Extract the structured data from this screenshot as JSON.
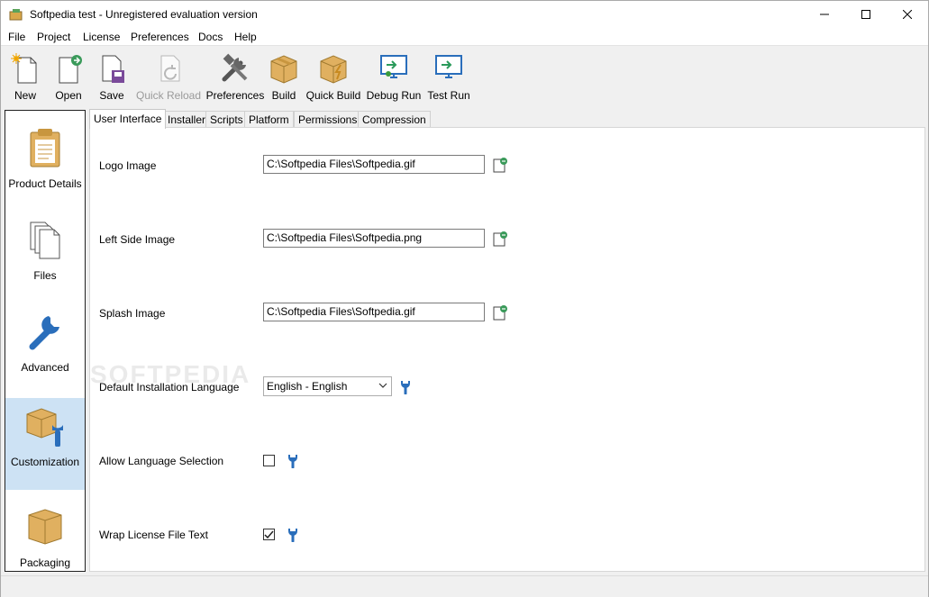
{
  "window": {
    "title": "Softpedia test - Unregistered evaluation version"
  },
  "menu": [
    "File",
    "Project",
    "License",
    "Preferences",
    "Docs",
    "Help"
  ],
  "toolbar": {
    "new": "New",
    "open": "Open",
    "save": "Save",
    "quick_reload": "Quick Reload",
    "preferences": "Preferences",
    "build": "Build",
    "quick_build": "Quick Build",
    "debug_run": "Debug Run",
    "test_run": "Test Run"
  },
  "sidebar": {
    "items": [
      {
        "label": "Product Details"
      },
      {
        "label": "Files"
      },
      {
        "label": "Advanced"
      },
      {
        "label": "Customization"
      },
      {
        "label": "Packaging"
      }
    ],
    "active": "Customization"
  },
  "tabs": [
    "User Interface",
    "Installer",
    "Scripts",
    "Platform",
    "Permissions",
    "Compression"
  ],
  "form": {
    "logo_image_label": "Logo Image",
    "logo_image_value": "C:\\Softpedia Files\\Softpedia.gif",
    "left_side_image_label": "Left Side Image",
    "left_side_image_value": "C:\\Softpedia Files\\Softpedia.png",
    "splash_image_label": "Splash Image",
    "splash_image_value": "C:\\Softpedia Files\\Softpedia.gif",
    "default_language_label": "Default Installation Language",
    "default_language_value": "English - English",
    "allow_language_label": "Allow Language Selection",
    "allow_language_checked": false,
    "wrap_license_label": "Wrap License File Text",
    "wrap_license_checked": true
  },
  "watermark": "SOFTPEDIA",
  "colors": {
    "accent": "#cde2f4",
    "icon_blue": "#2a6ebb",
    "box_gold": "#e0b060"
  }
}
